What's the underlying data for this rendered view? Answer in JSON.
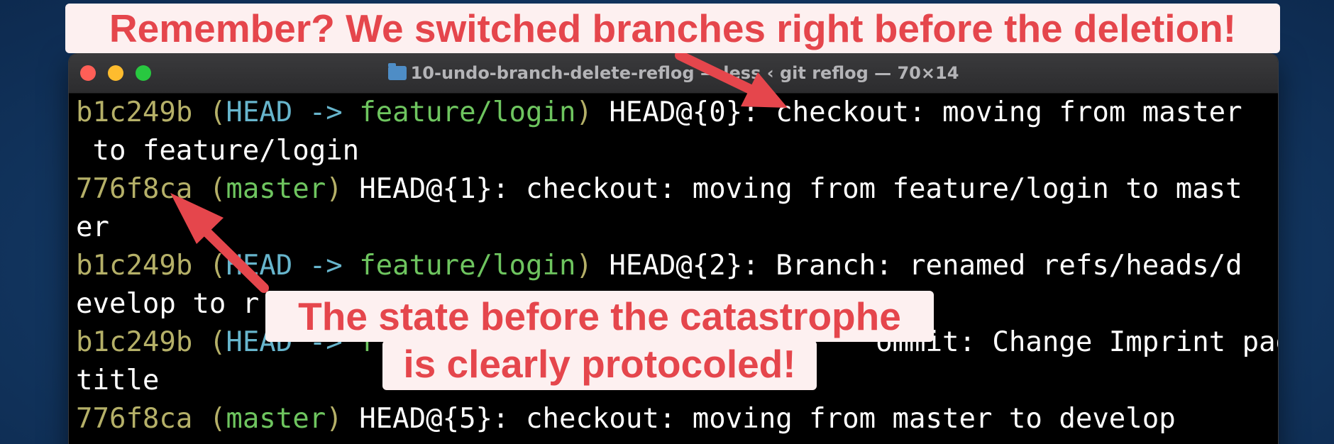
{
  "window": {
    "title": "10-undo-branch-delete-reflog — less ‹ git reflog — 70×14"
  },
  "terminal": {
    "lines": [
      [
        {
          "t": "b1c249b",
          "c": "hash"
        },
        {
          "t": " (",
          "c": "paren"
        },
        {
          "t": "HEAD",
          "c": "head"
        },
        {
          "t": " -> ",
          "c": "arrow"
        },
        {
          "t": "feature/login",
          "c": "branch"
        },
        {
          "t": ")",
          "c": "paren"
        },
        {
          "t": " HEAD@{0}: checkout: moving from master",
          "c": "text"
        }
      ],
      [
        {
          "t": " to feature/login",
          "c": "text"
        }
      ],
      [
        {
          "t": "776f8ca",
          "c": "hash"
        },
        {
          "t": " (",
          "c": "paren"
        },
        {
          "t": "master",
          "c": "branch"
        },
        {
          "t": ")",
          "c": "paren"
        },
        {
          "t": " HEAD@{1}: checkout: moving from feature/login to mast",
          "c": "text"
        }
      ],
      [
        {
          "t": "er",
          "c": "text"
        }
      ],
      [
        {
          "t": "b1c249b",
          "c": "hash"
        },
        {
          "t": " (",
          "c": "paren"
        },
        {
          "t": "HEAD",
          "c": "head"
        },
        {
          "t": " -> ",
          "c": "arrow"
        },
        {
          "t": "feature/login",
          "c": "branch"
        },
        {
          "t": ")",
          "c": "paren"
        },
        {
          "t": " HEAD@{2}: Branch: renamed refs/heads/d",
          "c": "text"
        }
      ],
      [
        {
          "t": "evelop to r",
          "c": "text"
        }
      ],
      [
        {
          "t": "b1c249b",
          "c": "hash"
        },
        {
          "t": " (",
          "c": "paren"
        },
        {
          "t": "HEAD",
          "c": "head"
        },
        {
          "t": " -> ",
          "c": "arrow"
        },
        {
          "t": "f",
          "c": "branch"
        },
        {
          "t": "                              ommit: Change Imprint page",
          "c": "text"
        }
      ],
      [
        {
          "t": "title",
          "c": "text"
        }
      ],
      [
        {
          "t": "776f8ca",
          "c": "hash"
        },
        {
          "t": " (",
          "c": "paren"
        },
        {
          "t": "master",
          "c": "branch"
        },
        {
          "t": ")",
          "c": "paren"
        },
        {
          "t": " HEAD@{5}: checkout: moving from master to develop",
          "c": "text"
        }
      ]
    ]
  },
  "callouts": {
    "top": "Remember? We switched branches right before the deletion!",
    "bottom_line1": "The state before the catastrophe",
    "bottom_line2": "is clearly protocoled!"
  },
  "colors": {
    "background": "#143a66",
    "callout_text": "#e5464c",
    "callout_bg": "#fdf0f0",
    "hash": "#b5b068",
    "head": "#67b5cc",
    "branch": "#6ec55f",
    "text": "#ffffff"
  },
  "icons": [
    "folder-icon",
    "close-icon",
    "minimize-icon",
    "zoom-icon",
    "arrow-icon"
  ]
}
